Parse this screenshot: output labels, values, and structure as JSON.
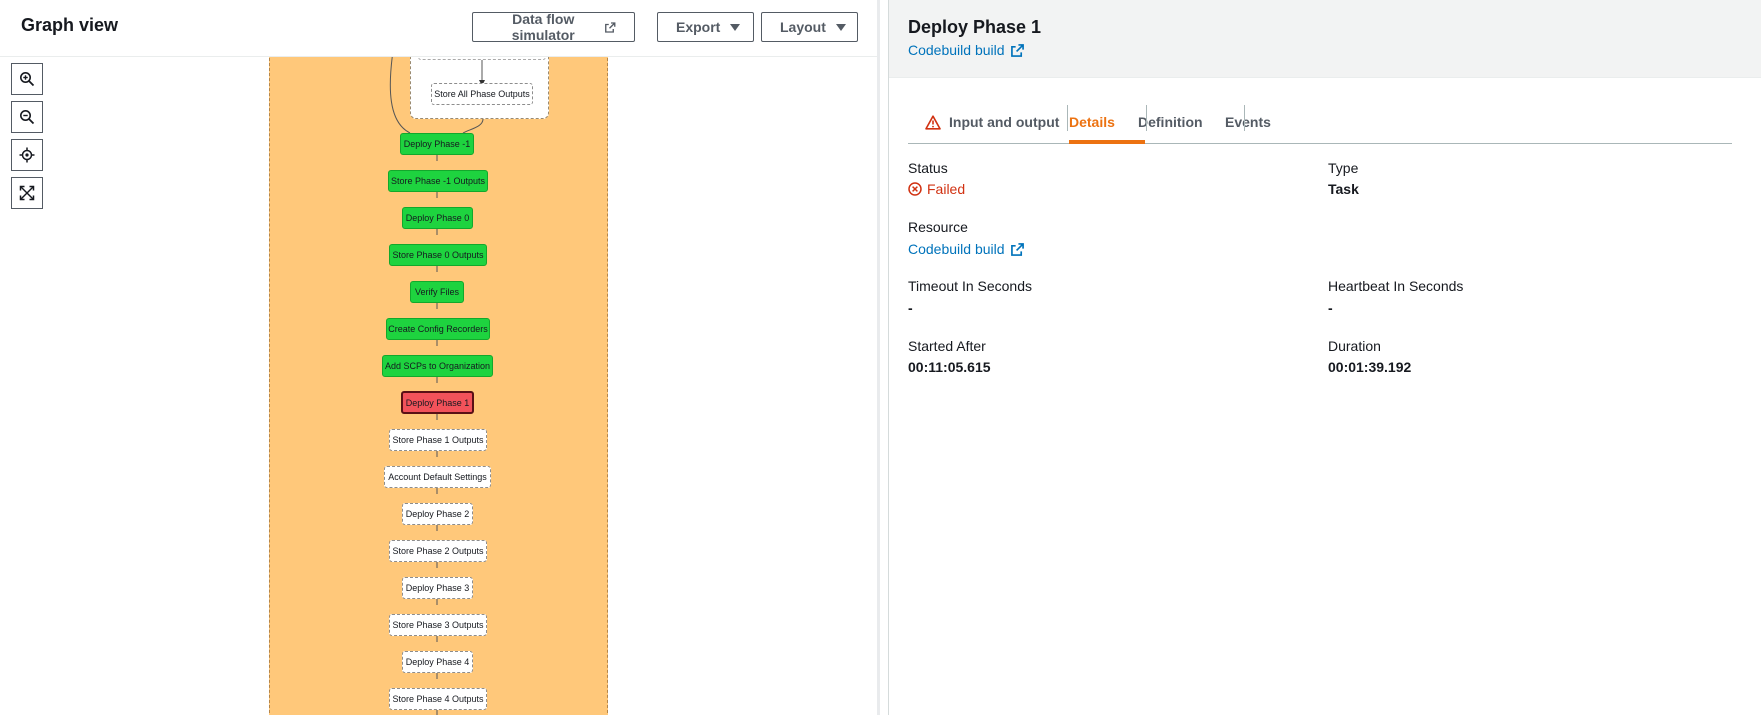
{
  "graph": {
    "title": "Graph view",
    "buttons": {
      "simulator": "Data flow simulator",
      "export": "Export",
      "layout": "Layout"
    },
    "nodes": [
      {
        "label": "Store All Phase Outputs",
        "status": "pending"
      },
      {
        "label": "Deploy Phase -1",
        "status": "succeeded"
      },
      {
        "label": "Store Phase -1 Outputs",
        "status": "succeeded"
      },
      {
        "label": "Deploy Phase 0",
        "status": "succeeded"
      },
      {
        "label": "Store Phase 0 Outputs",
        "status": "succeeded"
      },
      {
        "label": "Verify Files",
        "status": "succeeded"
      },
      {
        "label": "Create Config Recorders",
        "status": "succeeded"
      },
      {
        "label": "Add SCPs to Organization",
        "status": "succeeded"
      },
      {
        "label": "Deploy Phase 1",
        "status": "failed"
      },
      {
        "label": "Store Phase 1 Outputs",
        "status": "pending"
      },
      {
        "label": "Account Default Settings",
        "status": "pending"
      },
      {
        "label": "Deploy Phase 2",
        "status": "pending"
      },
      {
        "label": "Store Phase 2 Outputs",
        "status": "pending"
      },
      {
        "label": "Deploy Phase 3",
        "status": "pending"
      },
      {
        "label": "Store Phase 3 Outputs",
        "status": "pending"
      },
      {
        "label": "Deploy Phase 4",
        "status": "pending"
      },
      {
        "label": "Store Phase 4 Outputs",
        "status": "pending"
      }
    ],
    "colors": {
      "container": "#ffc87a",
      "succeeded": "#1ed33f",
      "failed": "#f2525a"
    }
  },
  "details": {
    "title": "Deploy Phase 1",
    "header_link": "Codebuild build",
    "tabs": {
      "input_output": "Input and output",
      "details": "Details",
      "definition": "Definition",
      "events": "Events"
    },
    "active_tab": "Details",
    "fields": {
      "status_label": "Status",
      "status_value": "Failed",
      "type_label": "Type",
      "type_value": "Task",
      "resource_label": "Resource",
      "resource_value": "Codebuild build",
      "timeout_label": "Timeout In Seconds",
      "timeout_value": "-",
      "heartbeat_label": "Heartbeat In Seconds",
      "heartbeat_value": "-",
      "started_label": "Started After",
      "started_value": "00:11:05.615",
      "duration_label": "Duration",
      "duration_value": "00:01:39.192"
    },
    "colors": {
      "accent": "#ec7211",
      "link": "#0073bb",
      "error": "#d13212"
    }
  }
}
